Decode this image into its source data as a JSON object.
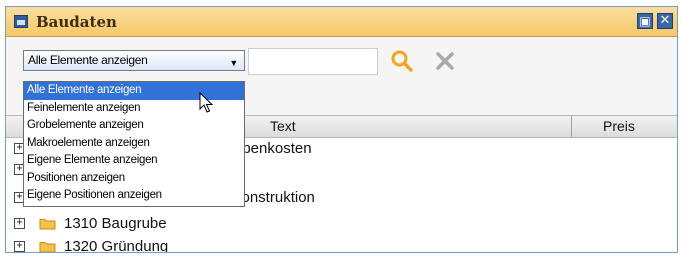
{
  "window": {
    "title": "Baudaten"
  },
  "toolbar": {
    "filter_selected": "Alle Elemente anzeigen",
    "search_value": ""
  },
  "filter_options": [
    "Alle Elemente anzeigen",
    "Feinelemente anzeigen",
    "Grobelemente anzeigen",
    "Makroelemente anzeigen",
    "Eigene Elemente anzeigen",
    "Positionen anzeigen",
    "Eigene Positionen anzeigen"
  ],
  "table": {
    "columns": [
      "Text",
      "Preis"
    ],
    "rows": [
      {
        "label": "ebenkosten"
      },
      {
        "label": ""
      },
      {
        "label": "konstruktion"
      },
      {
        "label": "1310 Baugrube"
      },
      {
        "label": "1320 Gründung"
      }
    ]
  },
  "colors": {
    "title_bar": "#f6c766",
    "accent": "#3a67a6",
    "selection": "#3172d8",
    "search_icon": "#f2a51f",
    "clear_icon": "#a9a9a9",
    "folder": "#f4c24b"
  },
  "icons": {
    "window": "window-icon",
    "maximize": "maximize-icon",
    "close": "close-icon",
    "search": "search-icon",
    "clear": "clear-icon",
    "expand": "plus-box-icon",
    "folder": "folder-icon",
    "cursor": "mouse-cursor-icon"
  }
}
